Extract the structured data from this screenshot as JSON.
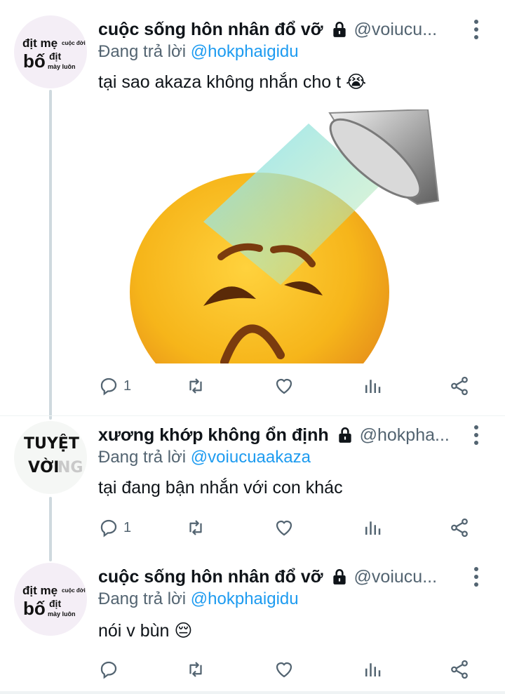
{
  "tweets": [
    {
      "name": "cuộc sống hôn nhân đổ vỡ",
      "handle": "@voiucu...",
      "reply_prefix": "Đang trả lời",
      "reply_to": "@hokphaigidu",
      "text": "tại sao akaza không nhắn cho t",
      "emoji": "😭",
      "reply_count": "1",
      "avatar": {
        "line1": "địt mẹ",
        "line1_small": "cuộc đời",
        "big": "bố",
        "small2": "địt",
        "small3": "mày luôn"
      },
      "media": {
        "description_icon": "crying-shower-emoji-image"
      }
    },
    {
      "name": "xương khớp không ổn định",
      "handle": "@hokpha...",
      "reply_prefix": "Đang trả lời",
      "reply_to": "@voiucuaakaza",
      "text": "tại đang bận nhắn với con khác",
      "reply_count": "1",
      "avatar": {
        "line1": "TUYỆT",
        "line2": "VỜI",
        "line2_faded": "NG"
      }
    },
    {
      "name": "cuộc sống hôn nhân đổ vỡ",
      "handle": "@voiucu...",
      "reply_prefix": "Đang trả lời",
      "reply_to": "@hokphaigidu",
      "text": "nói v bùn",
      "emoji": "😔",
      "reply_count": "",
      "avatar": {
        "line1": "địt mẹ",
        "line1_small": "cuộc đời",
        "big": "bố",
        "small2": "địt",
        "small3": "mày luôn"
      }
    }
  ],
  "icons": [
    "reply-icon",
    "retweet-icon",
    "like-icon",
    "analytics-icon",
    "share-icon",
    "lock-icon",
    "more-icon"
  ],
  "colors": {
    "link": "#1d9bf0",
    "secondary": "#536471",
    "text": "#0f1419",
    "thread": "#cfd9de"
  }
}
